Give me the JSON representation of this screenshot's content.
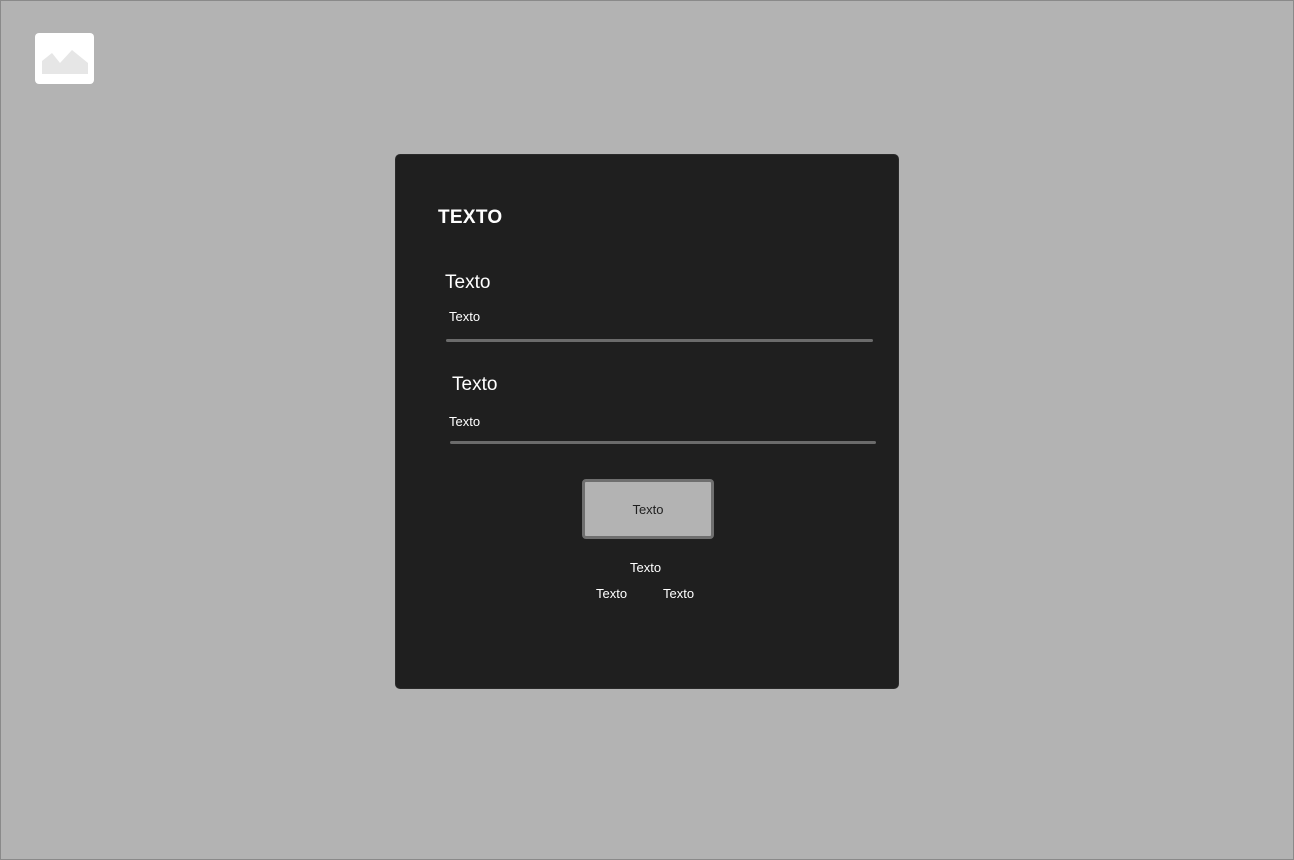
{
  "logo": {
    "icon": "image-placeholder-icon"
  },
  "card": {
    "title": "TEXTO",
    "fields": [
      {
        "label": "Texto",
        "value": "Texto"
      },
      {
        "label": "Texto",
        "value": "Texto"
      }
    ],
    "button_label": "Texto",
    "links": {
      "center": "Texto",
      "left": "Texto",
      "right": "Texto"
    }
  },
  "colors": {
    "page_background": "#b3b3b3",
    "card_background": "#1f1f1f",
    "input_underline": "#6b6b6b",
    "button_background": "#b3b3b3",
    "button_border": "#6f6f6f",
    "text_light": "#ffffff"
  }
}
